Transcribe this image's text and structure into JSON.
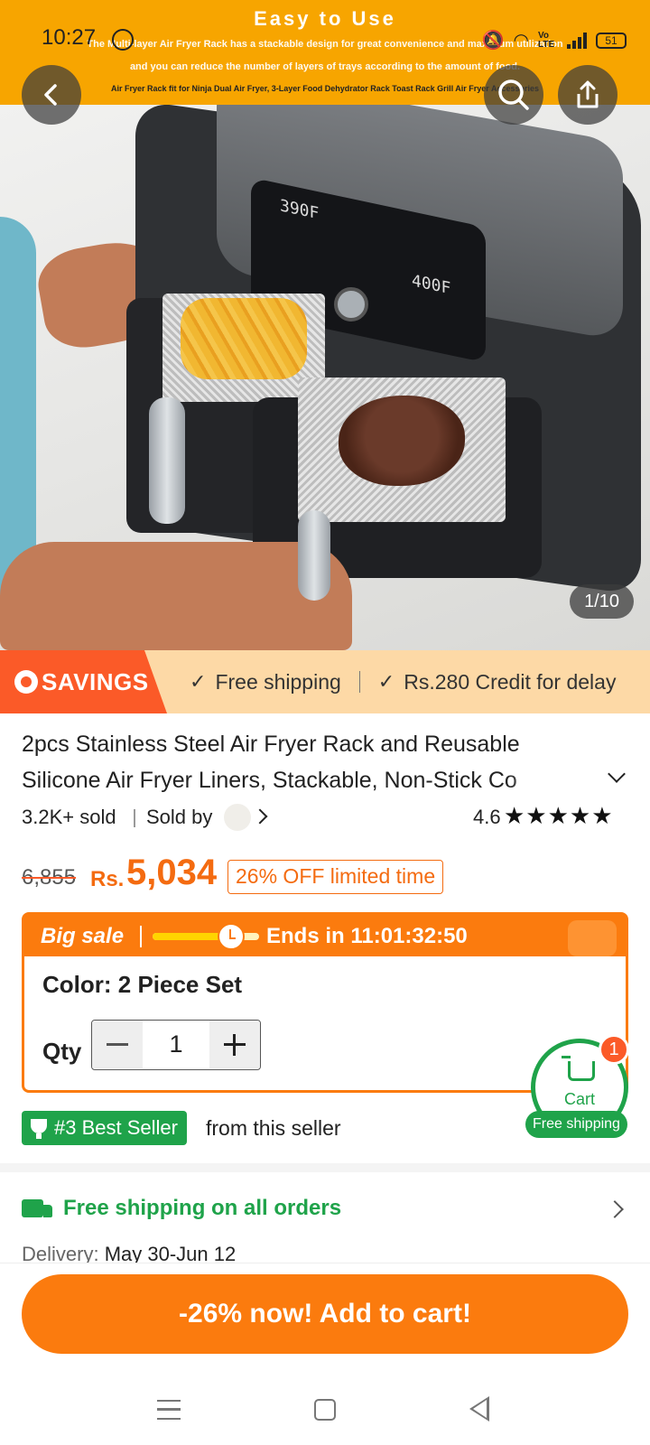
{
  "status_bar": {
    "time": "10:27",
    "battery": "51",
    "network": "Vo LTE"
  },
  "hero": {
    "banner_title": "Easy to Use",
    "banner_line1": "The Multi-layer Air Fryer Rack has a stackable design for great convenience and maximum utilization",
    "banner_line2": "and you can reduce the number of layers of trays according to the amount of food.",
    "banner_line3": "Air Fryer Rack fit for Ninja Dual Air Fryer, 3-Layer Food Dehydrator Rack Toast Rack Grill Air Fryer Accessories",
    "display_left": "390F",
    "display_right": "400F",
    "image_counter": "1/10"
  },
  "savings": {
    "label": "SAVINGS",
    "item1": "Free shipping",
    "item2": "Rs.280 Credit for delay"
  },
  "product": {
    "title": "2pcs Stainless Steel Air Fryer Rack and Reusable Silicone Air Fryer Liners, Stackable, Non-Stick Co",
    "sold": "3.2K+ sold",
    "sold_by": "Sold by",
    "rating": "4.6",
    "stars": "★★★★★",
    "rating_fraction": 0.92
  },
  "price": {
    "original": "6,855",
    "currency": "Rs.",
    "current": "5,034",
    "discount": "26% OFF limited time"
  },
  "sale": {
    "label": "Big sale",
    "progress": 0.72,
    "ends": "Ends in 11:01:32:50",
    "color": "Color: 2 Piece Set",
    "qty_label": "Qty",
    "qty_value": "1"
  },
  "cart": {
    "label": "Cart",
    "badge": "1",
    "shipping": "Free shipping"
  },
  "best_seller": {
    "label": "#3 Best Seller",
    "suffix": "from this seller"
  },
  "shipping": {
    "headline": "Free shipping on all orders",
    "delivery_label": "Delivery:",
    "delivery_value": "May 30-Jun 12"
  },
  "cta": {
    "label": "-26% now! Add to cart!"
  },
  "colors": {
    "accent": "#fb7b0e",
    "green": "#1fa34a",
    "savings_bg": "#fdd9a6"
  }
}
